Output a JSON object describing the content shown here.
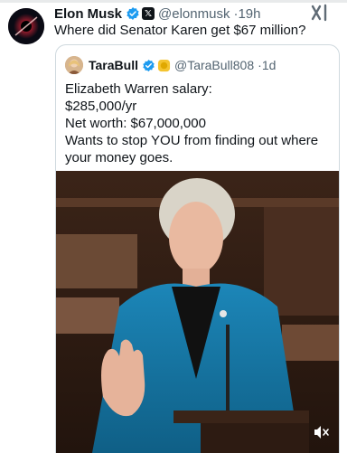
{
  "tweet": {
    "author_name": "Elon Musk",
    "author_handle": "@elonmusk",
    "separator": "·",
    "time": "19h",
    "text": "Where did Senator Karen get $67 million?"
  },
  "quoted": {
    "author_name": "TaraBull",
    "author_handle": "@TaraBull808",
    "separator": "·",
    "time": "1d",
    "lines": [
      "Elizabeth Warren salary:",
      "$285,000/yr",
      "Net worth: $67,000,000",
      "Wants to stop YOU from finding out where",
      "your money goes."
    ]
  },
  "media": {
    "type": "video"
  },
  "colors": {
    "verified": "#1d9bf0",
    "secondary_text": "#536471",
    "border": "#cfd9de"
  },
  "icons": [
    "verified-badge-icon",
    "x-logo-icon",
    "xai-logo-icon",
    "gold-badge-icon",
    "mute-icon"
  ]
}
